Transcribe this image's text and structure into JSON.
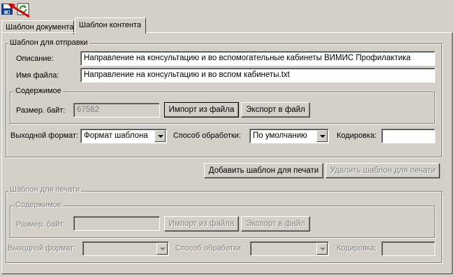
{
  "toolbar": {
    "save_icon": "floppy-disk-icon",
    "refresh_icon": "refresh-icon",
    "pointer_icon": "red-arrow-icon"
  },
  "tabs": [
    {
      "label": "Шаблон документа"
    },
    {
      "label": "Шаблон контента"
    }
  ],
  "send_template": {
    "legend": "Шаблон для отправки",
    "description_label": "Описание:",
    "description_value": "Направление на консультацию и во вспомогательные кабинеты ВИМИС Профилактика",
    "filename_label": "Имя файла:",
    "filename_value": "Направление на консультацию и во вспом кабинеты.txt",
    "content": {
      "legend": "Содержимое",
      "size_label": "Размер. байт:",
      "size_value": "67582",
      "import_button": "Импорт из файла",
      "export_button": "Экспорт в файл"
    },
    "output_format_label": "Выходной формат:",
    "output_format_value": "Формат шаблона",
    "processing_label": "Способ обработки:",
    "processing_value": "По умолчанию",
    "encoding_label": "Кодировка:",
    "encoding_value": ""
  },
  "actions": {
    "add_print_template": "Добавить шаблон для печати",
    "remove_print_template": "Удалить шаблон для печати"
  },
  "print_template": {
    "legend": "Шаблон для печати",
    "content": {
      "legend": "Содержимое",
      "size_label": "Размер. байт:",
      "size_value": "",
      "import_button": "Импорт из файла",
      "export_button": "Экспорт в файл"
    },
    "output_format_label": "Выходной формат:",
    "output_format_value": "",
    "processing_label": "Способ обработки:",
    "processing_value": "",
    "encoding_label": "Кодировка:",
    "encoding_value": ""
  },
  "colors": {
    "background": "#d4d0c8",
    "arrow": "#e00000",
    "disabled_text": "#808080"
  }
}
